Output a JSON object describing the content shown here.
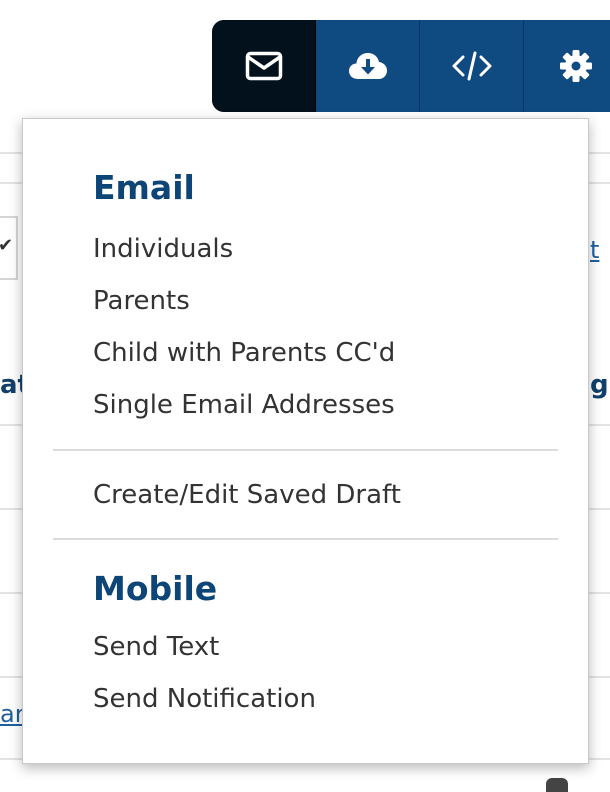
{
  "toolbar": {
    "buttons": [
      {
        "icon": "envelope-icon",
        "active": true
      },
      {
        "icon": "cloud-download-icon",
        "active": false
      },
      {
        "icon": "code-icon",
        "active": false
      },
      {
        "icon": "gear-icon",
        "active": false
      }
    ],
    "colors": {
      "button_bg": "#0f4a80",
      "active_bg": "#03111d",
      "icon": "#ffffff"
    }
  },
  "background": {
    "fragment_right_link": "t",
    "fragment_left_bold": "at",
    "fragment_right_bold": "g",
    "fragment_left_link": "ar",
    "check_icon": "check-icon"
  },
  "menu": {
    "email_section": {
      "heading": "Email",
      "items": [
        "Individuals",
        "Parents",
        "Child with Parents CC'd",
        "Single Email Addresses"
      ]
    },
    "draft_section": {
      "items": [
        "Create/Edit Saved Draft"
      ]
    },
    "mobile_section": {
      "heading": "Mobile",
      "items": [
        "Send Text",
        "Send Notification"
      ]
    },
    "colors": {
      "heading": "#0d4577",
      "item": "#333333"
    }
  }
}
